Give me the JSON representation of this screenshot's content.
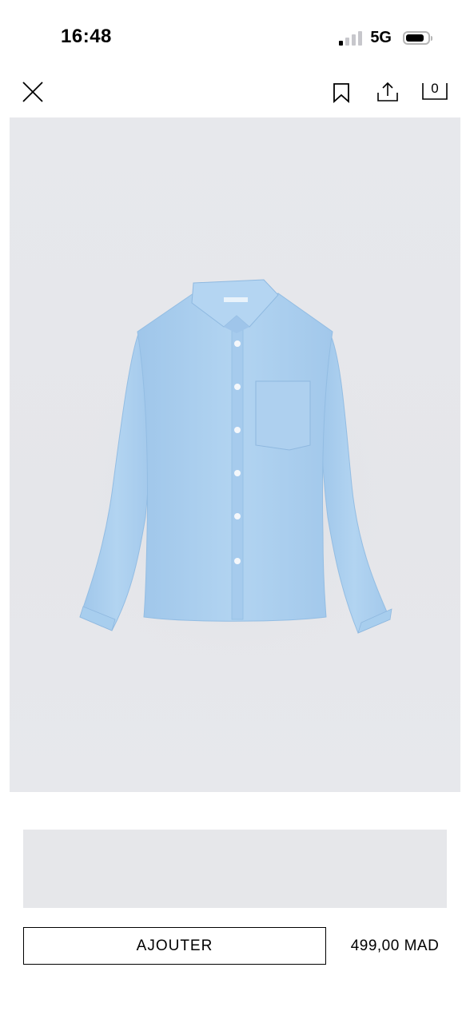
{
  "status_bar": {
    "time": "16:48",
    "network": "5G",
    "signal_bars_active": 1,
    "signal_bars_total": 4
  },
  "top_bar": {
    "close_icon": "close-icon",
    "bookmark_icon": "bookmark-icon",
    "share_icon": "share-icon",
    "cart_icon": "cart-icon",
    "cart_count": "0"
  },
  "product": {
    "image_label": "light-blue-shirt",
    "background_color": "#e6e7eb",
    "shirt_color": "#aed0ef"
  },
  "actions": {
    "add_label": "AJOUTER",
    "price": "499,00 MAD"
  }
}
